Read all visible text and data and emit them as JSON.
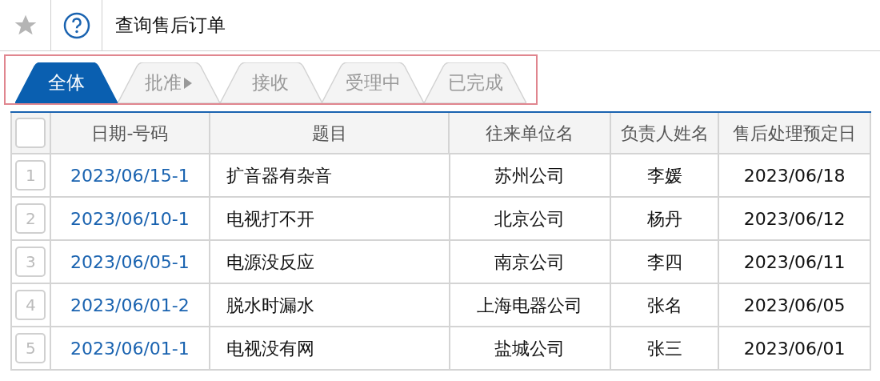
{
  "header": {
    "title": "查询售后订单"
  },
  "tabs": [
    {
      "label": "全体",
      "selected": true,
      "dropdown": false
    },
    {
      "label": "批准",
      "selected": false,
      "dropdown": true
    },
    {
      "label": "接收",
      "selected": false,
      "dropdown": false
    },
    {
      "label": "受理中",
      "selected": false,
      "dropdown": false
    },
    {
      "label": "已完成",
      "selected": false,
      "dropdown": false
    }
  ],
  "table": {
    "select_all_checked": false,
    "columns": [
      "日期-号码",
      "题目",
      "往来单位名",
      "负责人姓名",
      "售后处理预定日"
    ],
    "rows": [
      {
        "number": "1",
        "date_no": "2023/06/15-1",
        "subject": "扩音器有杂音",
        "company": "苏州公司",
        "person": "李媛",
        "due": "2023/06/18"
      },
      {
        "number": "2",
        "date_no": "2023/06/10-1",
        "subject": "电视打不开",
        "company": "北京公司",
        "person": "杨丹",
        "due": "2023/06/12"
      },
      {
        "number": "3",
        "date_no": "2023/06/05-1",
        "subject": "电源没反应",
        "company": "南京公司",
        "person": "李四",
        "due": "2023/06/11"
      },
      {
        "number": "4",
        "date_no": "2023/06/01-2",
        "subject": "脱水时漏水",
        "company": "上海电器公司",
        "person": "张名",
        "due": "2023/06/05"
      },
      {
        "number": "5",
        "date_no": "2023/06/01-1",
        "subject": "电视没有网",
        "company": "盐城公司",
        "person": "张三",
        "due": "2023/06/01"
      }
    ]
  }
}
